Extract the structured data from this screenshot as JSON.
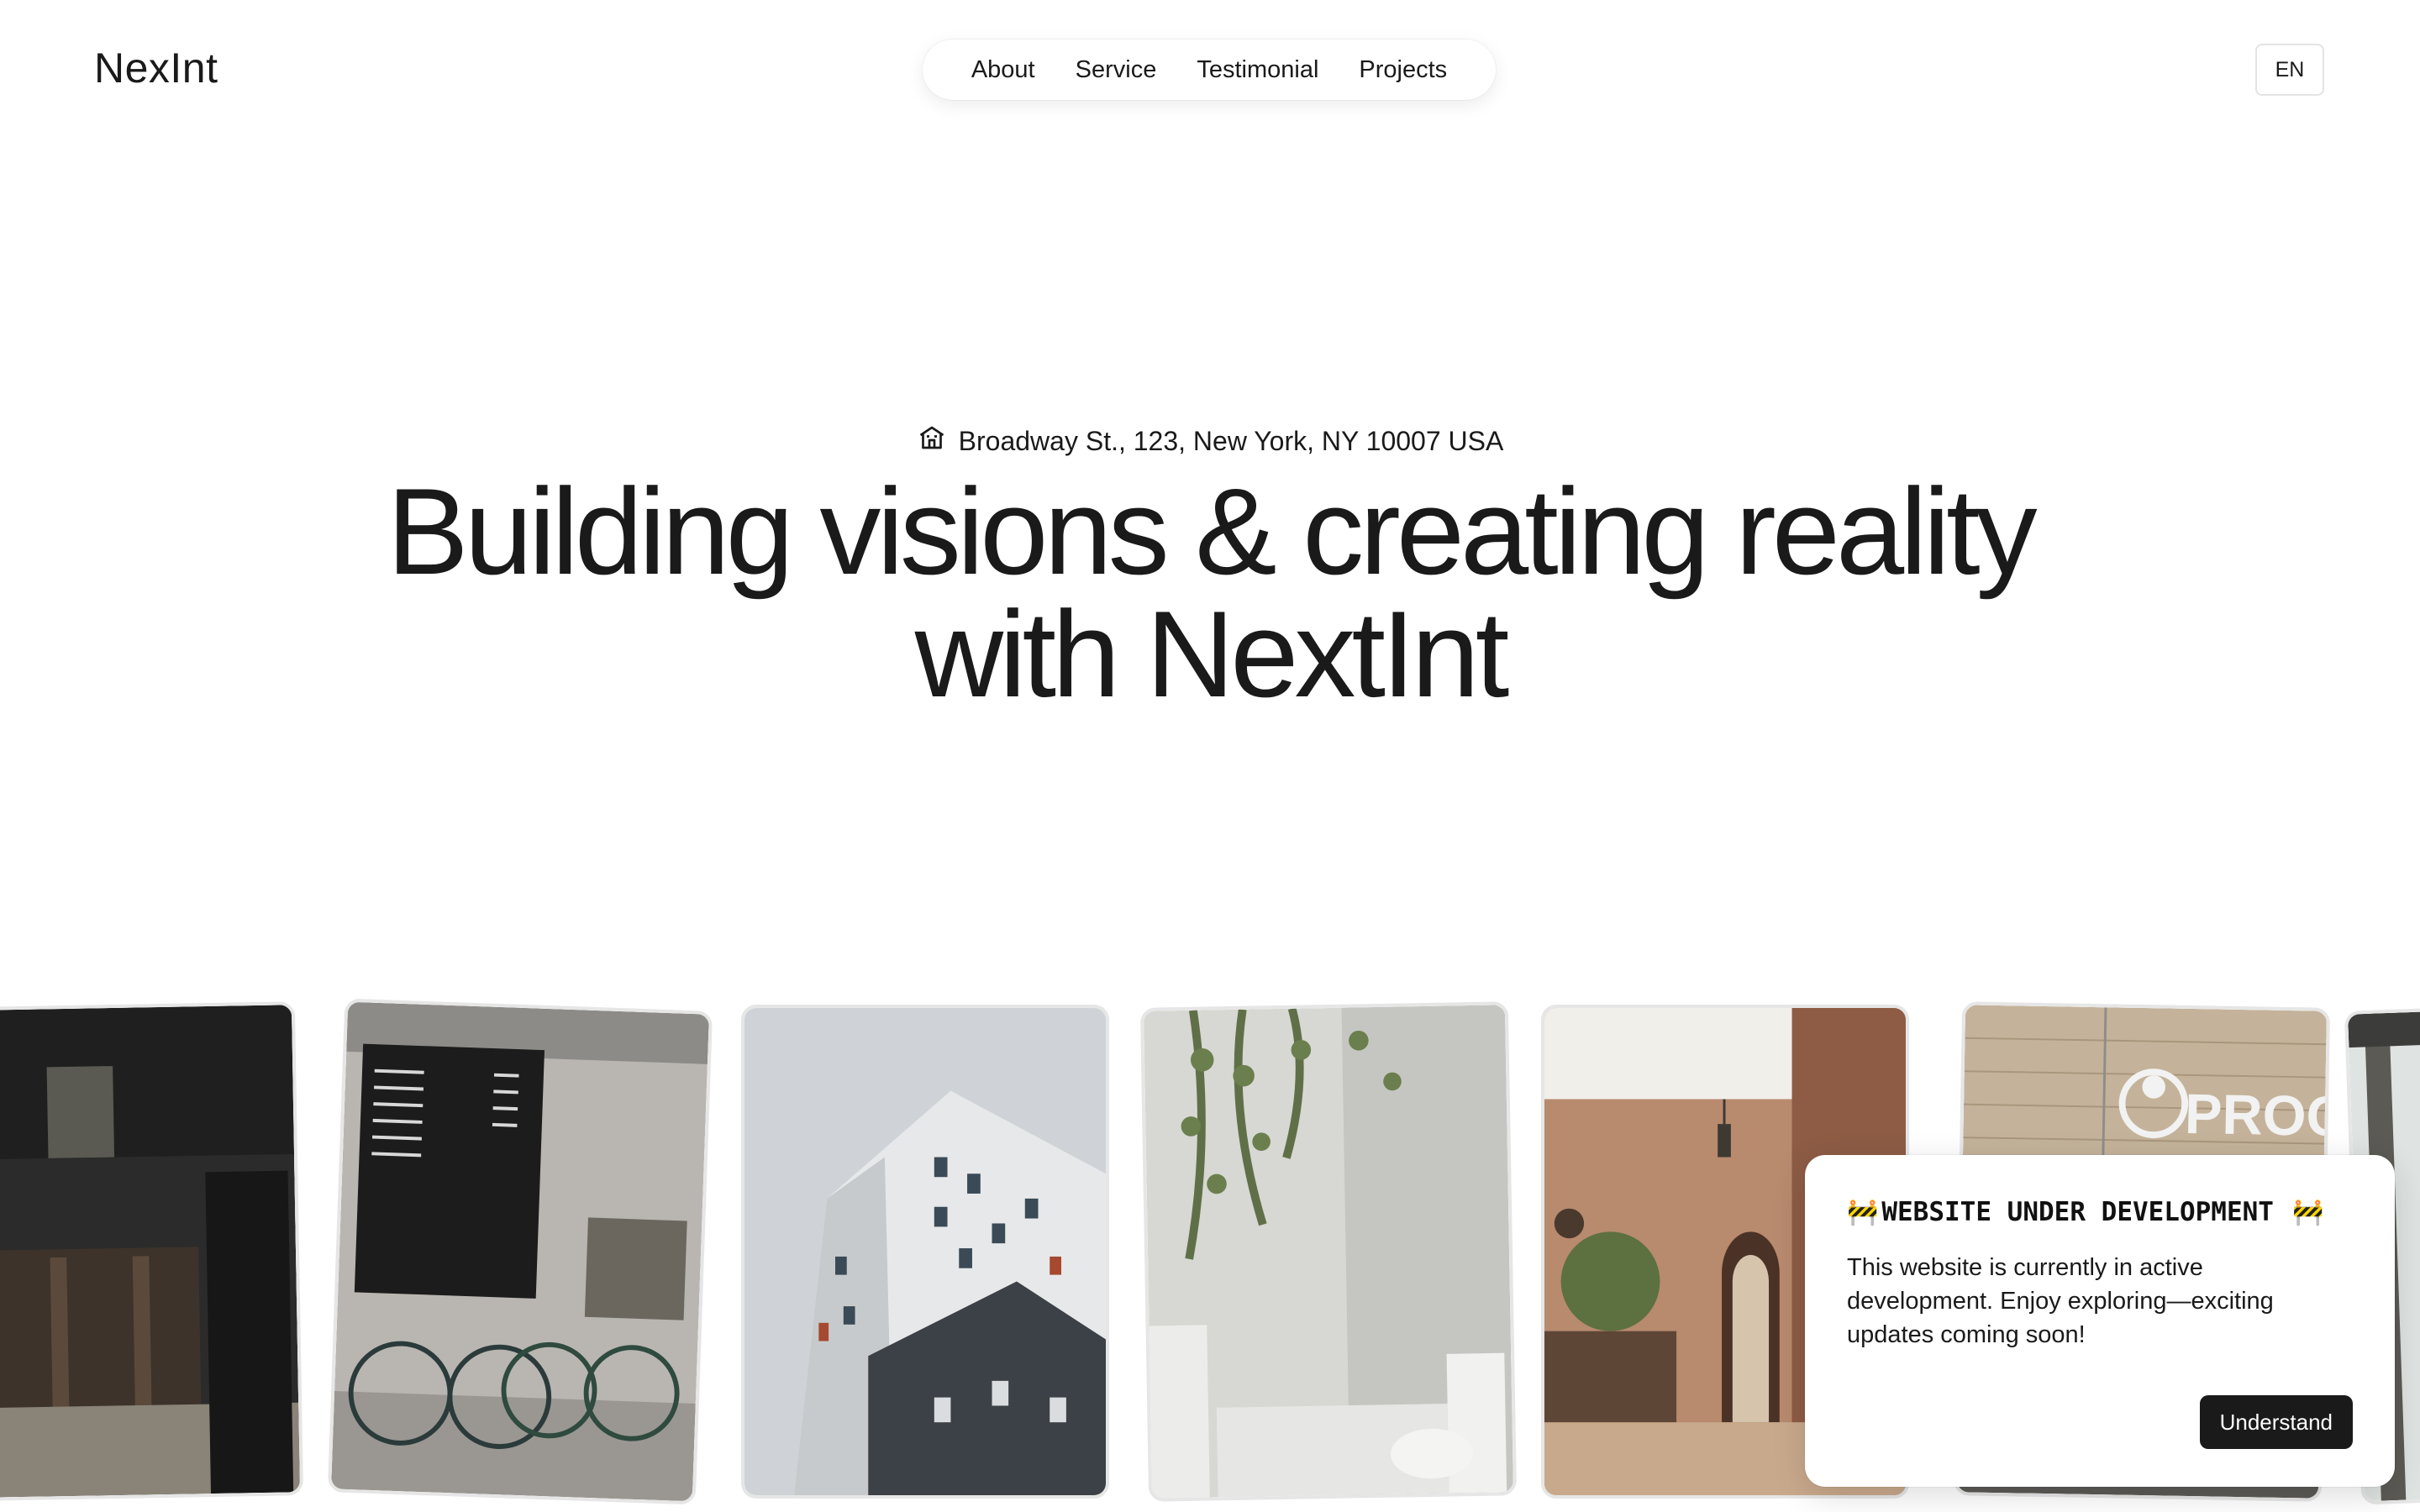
{
  "header": {
    "logo": "NexInt",
    "nav": [
      "About",
      "Service",
      "Testimonial",
      "Projects"
    ],
    "language": "EN"
  },
  "hero": {
    "address_icon": "building-icon",
    "address": "Broadway St., 123, New York, NY 10007 USA",
    "headline_line1": "Building visions & creating reality",
    "headline_line2": "with NextInt"
  },
  "gallery": {
    "images": [
      "dark-wood-cabin-photo",
      "cafe-with-bicycles-photo",
      "modern-building-facade-photo",
      "marble-shower-with-plants-photo",
      "terracotta-hallway-interior-photo",
      "brick-wall-sign-photo",
      "forest-photo"
    ],
    "sign_text": "PROC"
  },
  "notice": {
    "icon": "construction-icon",
    "title": "WEBSITE UNDER DEVELOPMENT",
    "body": "This website is currently in active development. Enjoy exploring—exciting updates coming soon!",
    "button": "Understand"
  },
  "colors": {
    "text": "#1a1a1a",
    "background": "#ffffff",
    "button_bg": "#1a1a1a"
  }
}
